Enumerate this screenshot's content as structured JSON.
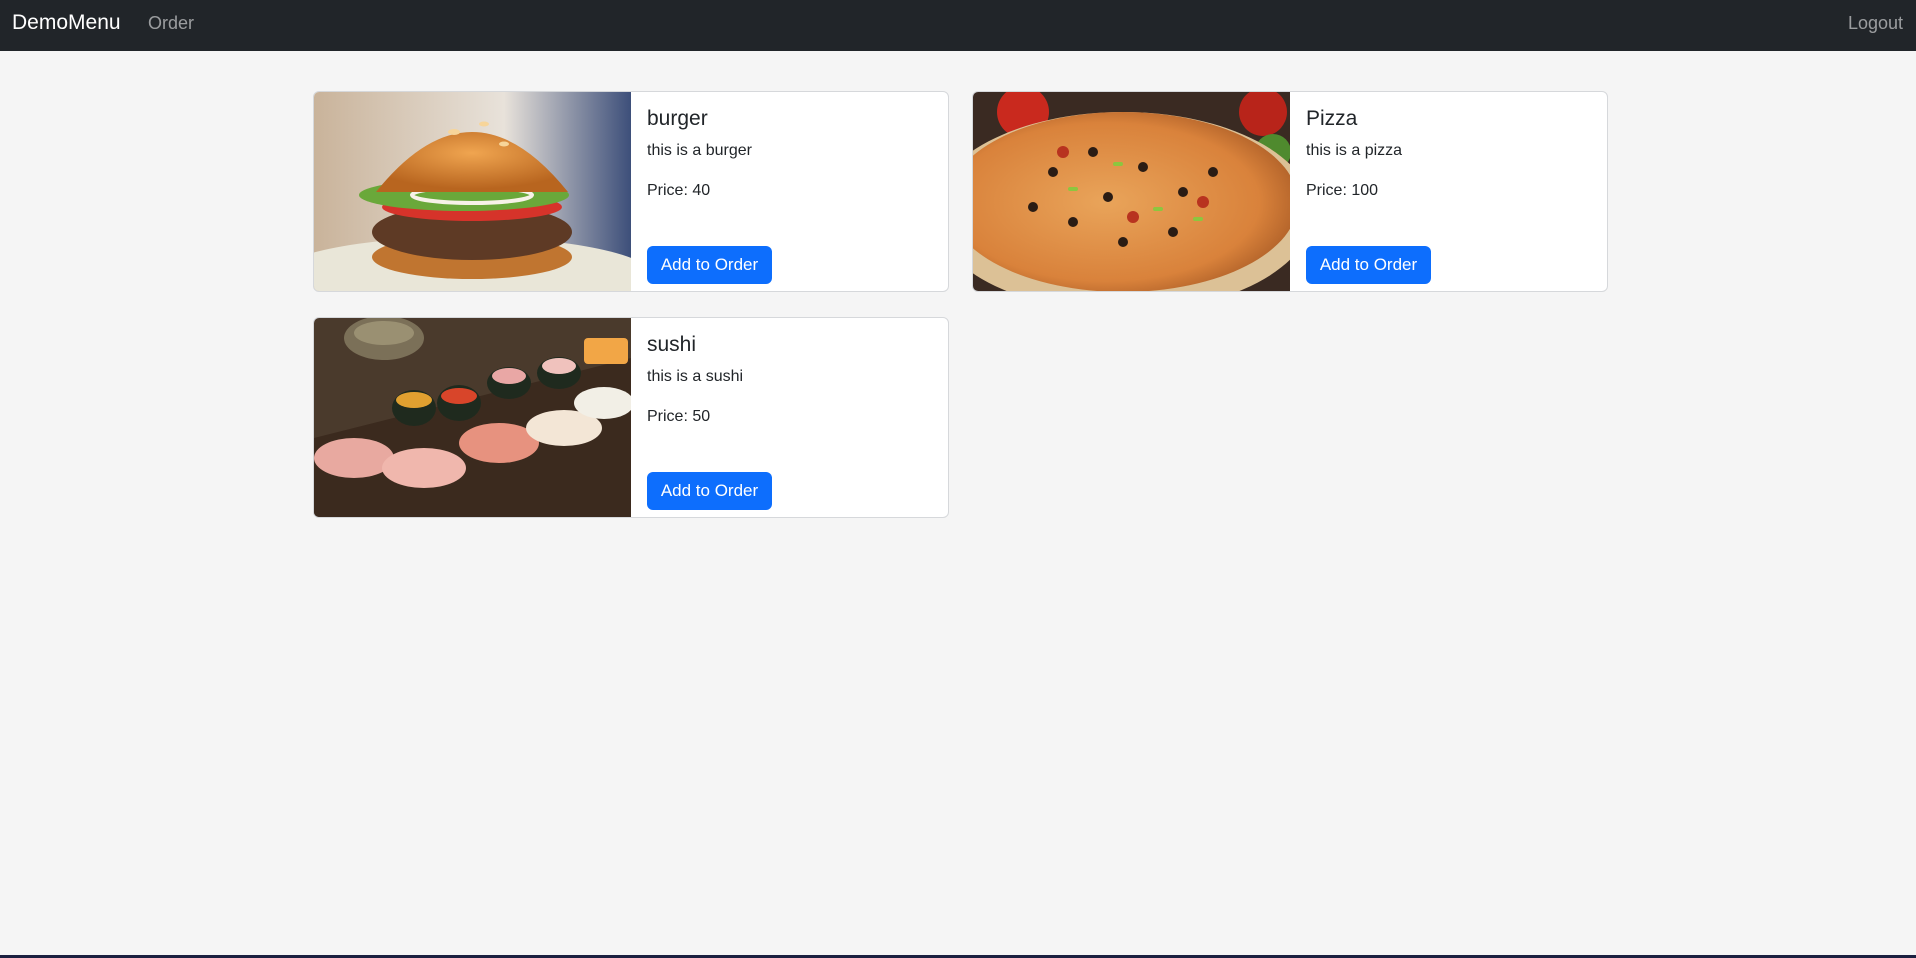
{
  "navbar": {
    "brand": "DemoMenu",
    "order_link": "Order",
    "logout_link": "Logout"
  },
  "menu_items": [
    {
      "name": "burger",
      "description": "this is a burger",
      "price_text": "Price: 40",
      "button_label": "Add to Order"
    },
    {
      "name": "Pizza",
      "description": "this is a pizza",
      "price_text": "Price: 100",
      "button_label": "Add to Order"
    },
    {
      "name": "sushi",
      "description": "this is a sushi",
      "price_text": "Price: 50",
      "button_label": "Add to Order"
    }
  ],
  "colors": {
    "navbar_bg": "#212529",
    "page_bg": "#f5f5f5",
    "button_bg": "#0d6efd"
  }
}
